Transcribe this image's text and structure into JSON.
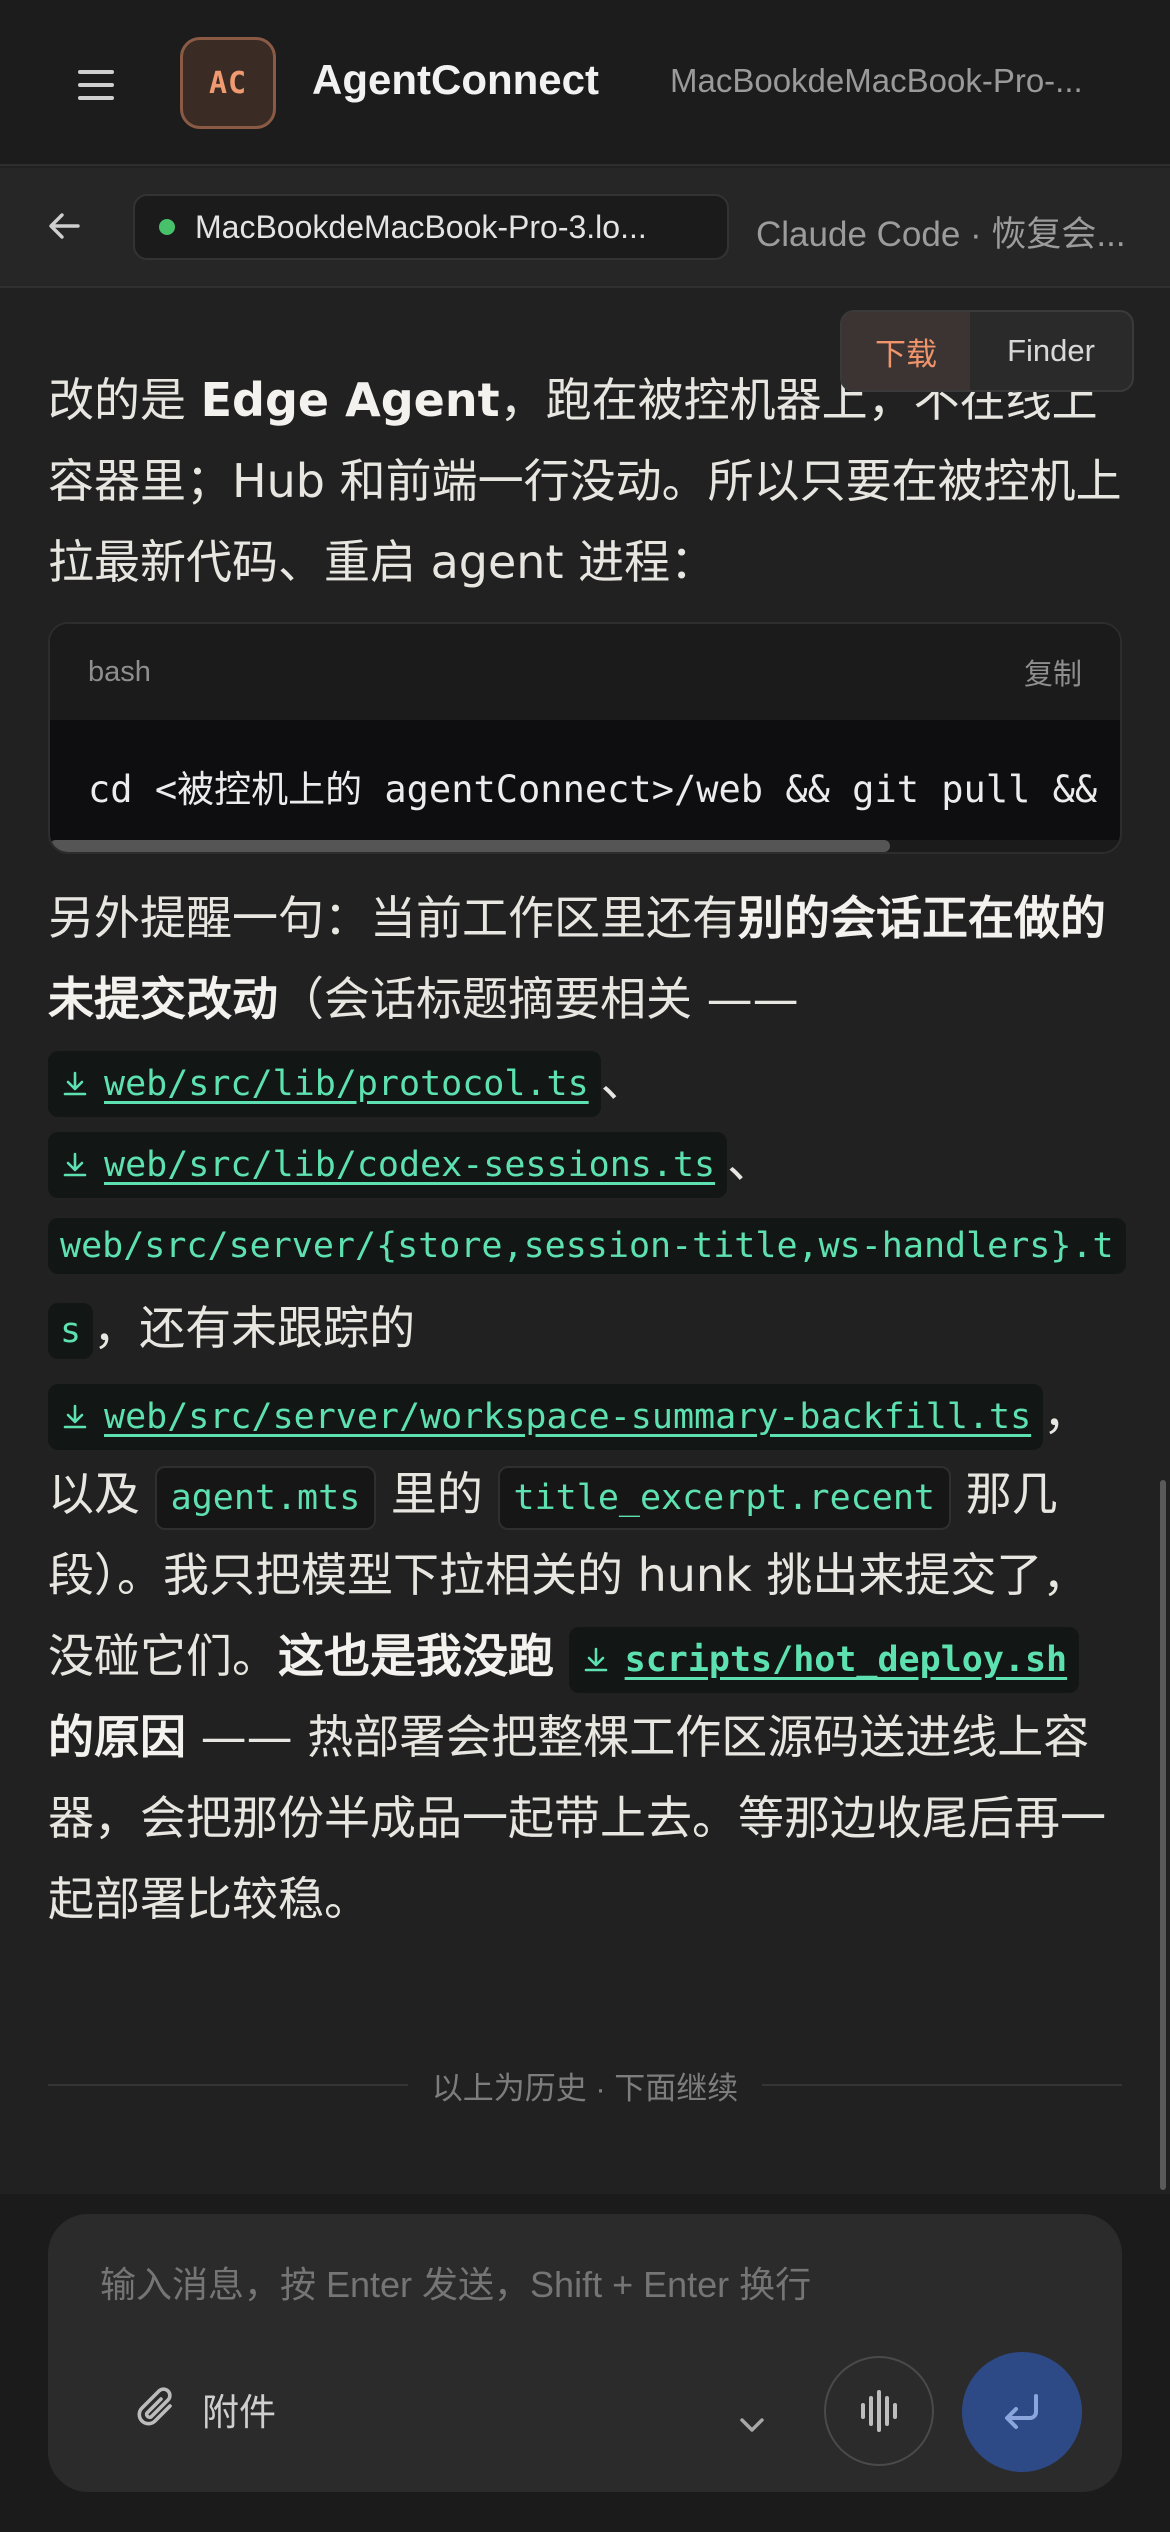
{
  "app": {
    "logo_text": "AC",
    "title": "AgentConnect",
    "host": "MacBookdeMacBook-Pro-..."
  },
  "session": {
    "chip_label": "MacBookdeMacBook-Pro-3.lo...",
    "status_color": "#47c26b",
    "title": "Claude Code · 恢复会..."
  },
  "view_toggle": {
    "download": "下载",
    "finder": "Finder"
  },
  "message": {
    "p1_prefix": "改的是 ",
    "p1_bold": "Edge Agent",
    "p1_suffix": "，跑在被控机器上，不在线上容器里；Hub 和前端一行没动。所以只要在被控机上拉最新代码、重启 agent 进程：",
    "code": {
      "lang": "bash",
      "copy_label": "复制",
      "line": "cd <被控机上的 agentConnect>/web && git pull && bu"
    },
    "p2_lead": "另外提醒一句：当前工作区里还有",
    "p2_bold": "别的会话正在做的未提交改动",
    "p2_after": "（会话标题摘要相关 ——",
    "file1": "web/src/lib/protocol.ts",
    "sep1": "、",
    "file2": "web/src/lib/codex-sessions.ts",
    "sep2": "、",
    "file3": "web/src/server/{store,session-title,ws-handlers}.ts",
    "after_file3": "，还有未跟踪的",
    "file4": "web/src/server/workspace-summary-backfill.ts",
    "after_file4": "，",
    "also": "以及",
    "code_agent": "agent.mts",
    "mid": "里的",
    "code_title": "title_excerpt.recent",
    "after_title": "那几段）。我只把模型下拉相关的 hunk 挑出来提交了，没碰它们。",
    "bold_reason_a": "这也是我没跑",
    "file5": "scripts/hot_deploy.sh",
    "bold_reason_b": "的原因",
    "ending": " —— 热部署会把整棵工作区源码送进线上容器，会把那份半成品一起带上去。等那边收尾后再一起部署比较稳。"
  },
  "divider": "以上为历史 · 下面继续",
  "composer": {
    "placeholder": "输入消息，按 Enter 发送，Shift + Enter 换行",
    "attach": "附件",
    "send_color": "#2e4a86"
  },
  "icons": {
    "menu": "hamburger-icon",
    "back": "arrow-left-icon",
    "download": "download-icon",
    "attach": "paperclip-icon",
    "chevron": "chevron-down-icon",
    "voice": "waveform-icon",
    "send": "enter-return-icon"
  }
}
